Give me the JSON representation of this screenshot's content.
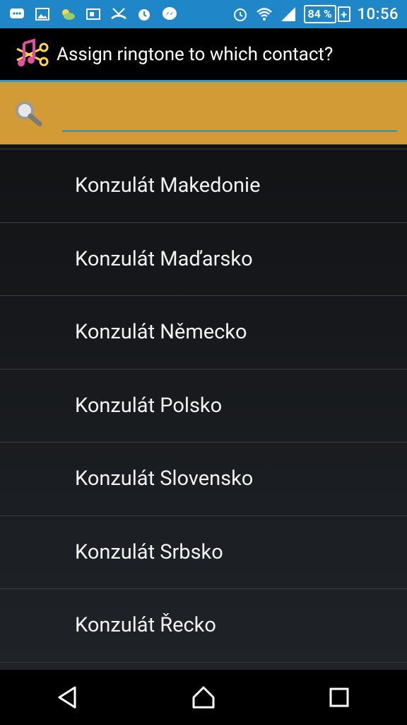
{
  "status": {
    "battery": "84 %",
    "time": "10:56",
    "icons_left": [
      "chat-bubble-icon",
      "image-icon",
      "weather-icon",
      "sim-icon",
      "missed-call-icon",
      "alarm-app-icon",
      "messenger-icon"
    ],
    "icons_right": [
      "alarm-icon",
      "wifi-icon",
      "signal-icon",
      "battery-icon"
    ]
  },
  "app": {
    "title": "Assign ringtone to which contact?"
  },
  "search": {
    "placeholder": "",
    "value": ""
  },
  "contacts": [
    {
      "name": "Konzulát Makedonie"
    },
    {
      "name": "Konzulát Maďarsko"
    },
    {
      "name": "Konzulát Německo"
    },
    {
      "name": "Konzulát Polsko"
    },
    {
      "name": "Konzulát Slovensko"
    },
    {
      "name": "Konzulát Srbsko"
    },
    {
      "name": "Konzulát Řecko"
    }
  ],
  "colors": {
    "statusbar": "#1f86c8",
    "search_bg": "#d39b36",
    "accent": "#2aa0d5"
  },
  "nav": [
    "back-icon",
    "home-icon",
    "recents-icon"
  ]
}
